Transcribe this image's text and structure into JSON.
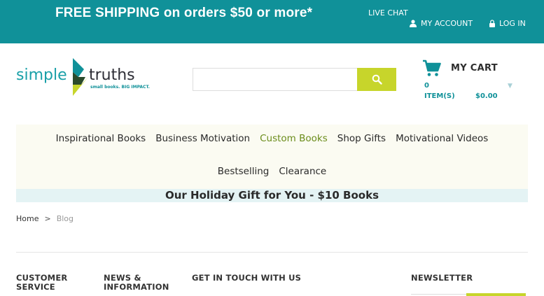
{
  "topbar": {
    "promo": "FREE SHIPPING on orders $50 or more*",
    "live_chat": "LIVE CHAT",
    "my_account": "MY ACCOUNT",
    "log_in": "LOG IN"
  },
  "logo": {
    "simple": "simple",
    "truths": "truths",
    "tagline": "small books. BIG IMPACT."
  },
  "search": {
    "value": "",
    "placeholder": ""
  },
  "cart": {
    "title": "MY CART",
    "count": "0",
    "items_label": "ITEM(S)",
    "total": "$0.00"
  },
  "nav": {
    "row1": [
      "Inspirational Books",
      "Business Motivation",
      "Custom Books",
      "Shop Gifts",
      "Motivational Videos"
    ],
    "row2": [
      "Bestselling",
      "Clearance"
    ],
    "active": "Custom Books"
  },
  "banner": {
    "text": "Our Holiday Gift for You - $10 Books"
  },
  "breadcrumb": {
    "home": "Home",
    "separator": ">",
    "current": "Blog"
  },
  "footer": {
    "col1_line1": "CUSTOMER",
    "col1_line2": "SERVICE",
    "col2_line1": "NEWS &",
    "col2_line2": "INFORMATION",
    "col3": "GET IN TOUCH WITH US",
    "col4": "NEWSLETTER"
  },
  "colors": {
    "brand_teal": "#109199",
    "accent_lime": "#c7d52b",
    "nav_active": "#6a8c1a"
  },
  "icons": [
    "user-icon",
    "lock-icon",
    "search-icon",
    "cart-icon",
    "chevron-down-icon"
  ]
}
